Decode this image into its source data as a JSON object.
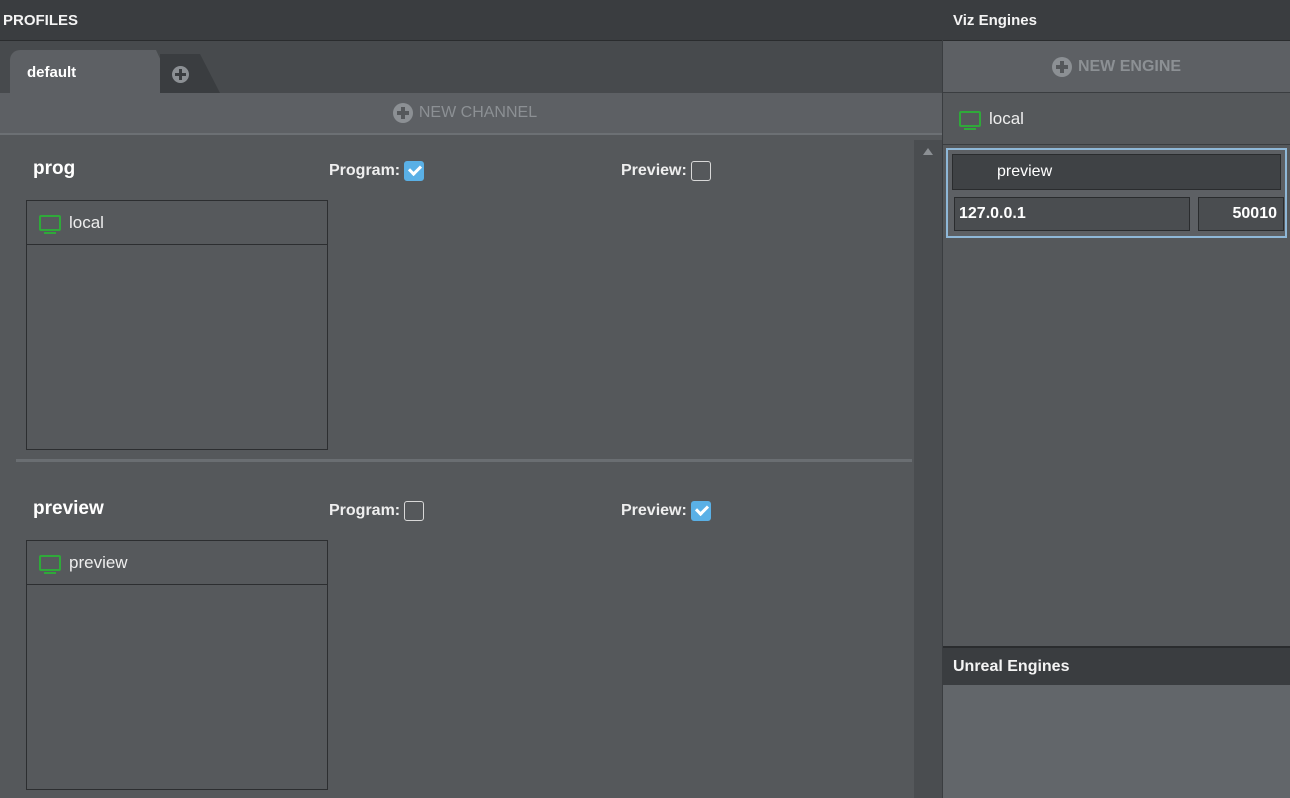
{
  "profiles": {
    "title": "PROFILES",
    "tabs": [
      {
        "label": "default",
        "active": true
      }
    ],
    "new_channel_label": "NEW CHANNEL",
    "channels": [
      {
        "name": "prog",
        "program_label": "Program:",
        "program_checked": true,
        "preview_label": "Preview:",
        "preview_checked": false,
        "engines": [
          "local"
        ]
      },
      {
        "name": "preview",
        "program_label": "Program:",
        "program_checked": false,
        "preview_label": "Preview:",
        "preview_checked": true,
        "engines": [
          "preview"
        ]
      }
    ]
  },
  "viz_engines": {
    "title": "Viz Engines",
    "new_engine_label": "NEW ENGINE",
    "engines": [
      {
        "name": "local"
      },
      {
        "name": "preview",
        "host": "127.0.0.1",
        "port": "50010",
        "selected": true
      }
    ]
  },
  "unreal_engines": {
    "title": "Unreal Engines"
  },
  "colors": {
    "accent": "#5ab0e6",
    "engine_icon": "#2fa93a",
    "selection_border": "#8fb8d8"
  },
  "icons": {
    "add": "plus-circle-icon",
    "engine": "monitor-icon",
    "check": "checkmark-icon"
  }
}
